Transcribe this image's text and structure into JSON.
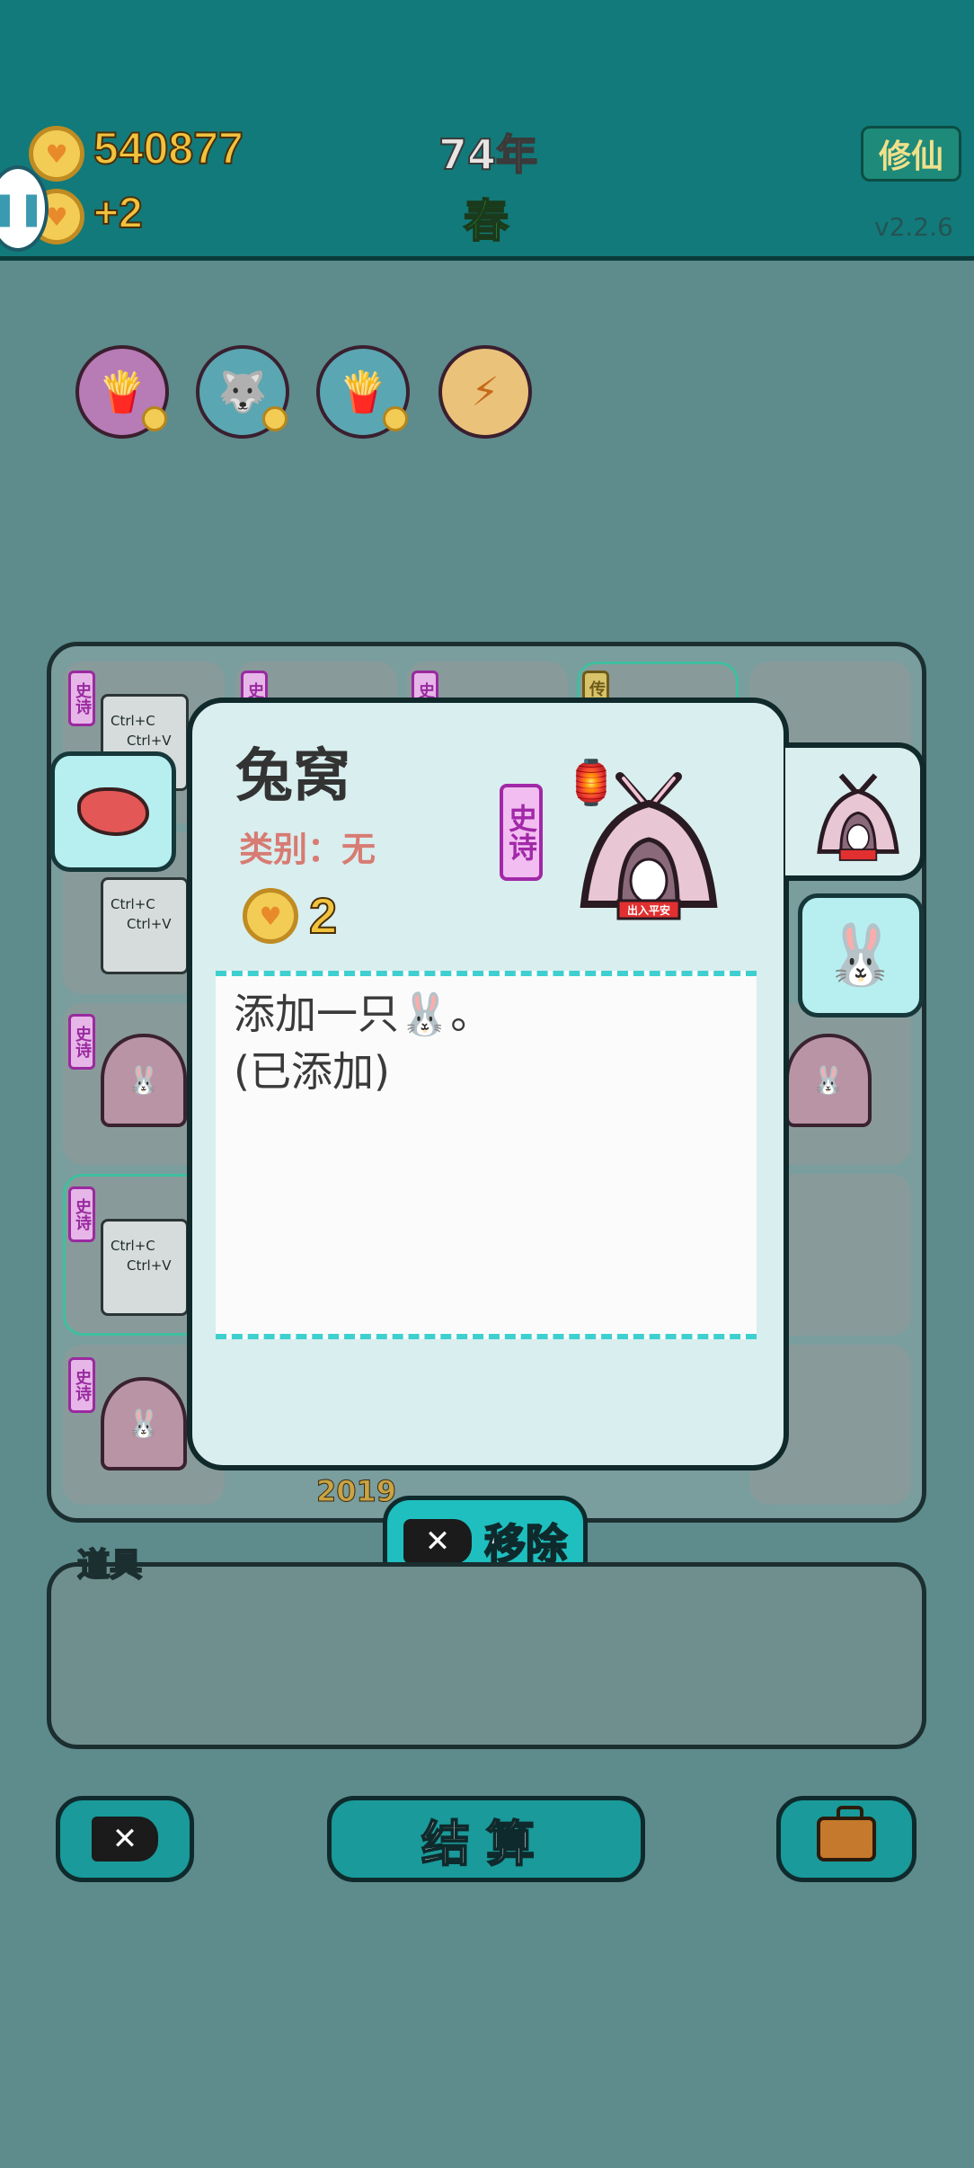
{
  "header": {
    "gold": "540877",
    "gold_income": "+2",
    "year": "74年",
    "season": "春",
    "xiuxian_button": "修仙",
    "version": "v2.2.6",
    "pause_icon": "pause-icon"
  },
  "relics": [
    {
      "name": "fries-icon"
    },
    {
      "name": "husky-dog-icon"
    },
    {
      "name": "fries-icon"
    },
    {
      "name": "lightning-icon"
    }
  ],
  "board": {
    "tags": [
      "史诗",
      "史诗",
      "史诗",
      "传",
      "史诗",
      "史诗",
      "史诗",
      "史诗"
    ],
    "ctrl_card_lines": [
      "Ctrl+C",
      "Ctrl+V"
    ],
    "bottom_label": "2019"
  },
  "detail": {
    "title": "兔窝",
    "category": "类别：无",
    "coin_value": "2",
    "rarity": "史诗",
    "description_line1": "添加一只",
    "description_line1_end": "。",
    "description_line2": "(已添加)",
    "hut_sign": "出入平安"
  },
  "remove_button": {
    "label": "移除",
    "icon": "close-x-icon"
  },
  "items": {
    "label": "道具"
  },
  "bottom_bar": {
    "skip_icon": "skip-x-icon",
    "settle_label": "结算",
    "bag_icon": "briefcase-icon"
  },
  "colors": {
    "background": "#5e8b8c",
    "header": "#127a7a",
    "card": "#d9eeee",
    "accent_teal": "#1fbfbf",
    "gold_text": "#f2c23e",
    "epic_purple": "#a128a8"
  }
}
